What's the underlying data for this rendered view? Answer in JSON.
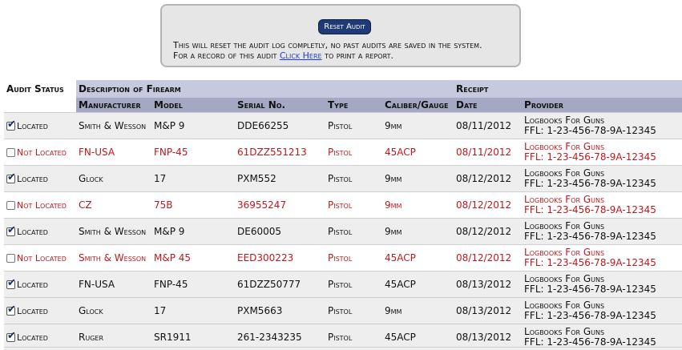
{
  "notice": {
    "reset_label": "Reset Audit",
    "line1": "This will reset the audit log completly, no past audits are saved in the system.",
    "line2_before": "For a record of this audit",
    "link_label": "Click Here",
    "line2_after": "to print a report."
  },
  "table": {
    "headers": {
      "audit_status": "Audit Status",
      "description": "Description of Firearm",
      "receipt": "Receipt",
      "manufacturer": "Manufacturer",
      "model": "Model",
      "serial": "Serial No.",
      "type": "Type",
      "caliber": "Caliber/Gauge",
      "date": "Date",
      "provider": "Provider"
    },
    "rows": [
      {
        "located": true,
        "status": "Located",
        "manufacturer": "Smith & Wesson",
        "model": "M&P 9",
        "serial": "DDE66255",
        "type": "Pistol",
        "caliber": "9mm",
        "date": "08/11/2012",
        "provider_name": "Logbooks For Guns",
        "provider_ffl": "FFL: 1-23-456-78-9A-12345"
      },
      {
        "located": false,
        "status": "Not Located",
        "manufacturer": "FN-USA",
        "model": "FNP-45",
        "serial": "61DZZ551213",
        "type": "Pistol",
        "caliber": "45ACP",
        "date": "08/11/2012",
        "provider_name": "Logbooks For Guns",
        "provider_ffl": "FFL: 1-23-456-78-9A-12345"
      },
      {
        "located": true,
        "status": "Located",
        "manufacturer": "Glock",
        "model": "17",
        "serial": "PXM552",
        "type": "Pistol",
        "caliber": "9mm",
        "date": "08/12/2012",
        "provider_name": "Logbooks For Guns",
        "provider_ffl": "FFL: 1-23-456-78-9A-12345"
      },
      {
        "located": false,
        "status": "Not Located",
        "manufacturer": "CZ",
        "model": "75B",
        "serial": "36955247",
        "type": "Pistol",
        "caliber": "9mm",
        "date": "08/12/2012",
        "provider_name": "Logbooks For Guns",
        "provider_ffl": "FFL: 1-23-456-78-9A-12345"
      },
      {
        "located": true,
        "status": "Located",
        "manufacturer": "Smith & Wesson",
        "model": "M&P 9",
        "serial": "DE60005",
        "type": "Pistol",
        "caliber": "9mm",
        "date": "08/12/2012",
        "provider_name": "Logbooks For Guns",
        "provider_ffl": "FFL: 1-23-456-78-9A-12345"
      },
      {
        "located": false,
        "status": "Not Located",
        "manufacturer": "Smith & Wesson",
        "model": "M&P 45",
        "serial": "EED300223",
        "type": "Pistol",
        "caliber": "45ACP",
        "date": "08/12/2012",
        "provider_name": "Logbooks For Guns",
        "provider_ffl": "FFL: 1-23-456-78-9A-12345"
      },
      {
        "located": true,
        "status": "Located",
        "manufacturer": "FN-USA",
        "model": "FNP-45",
        "serial": "61DZZ50777",
        "type": "Pistol",
        "caliber": "45ACP",
        "date": "08/13/2012",
        "provider_name": "Logbooks For Guns",
        "provider_ffl": "FFL: 1-23-456-78-9A-12345"
      },
      {
        "located": true,
        "status": "Located",
        "manufacturer": "Glock",
        "model": "17",
        "serial": "PXM5663",
        "type": "Pistol",
        "caliber": "9mm",
        "date": "08/13/2012",
        "provider_name": "Logbooks For Guns",
        "provider_ffl": "FFL: 1-23-456-78-9A-12345"
      },
      {
        "located": true,
        "status": "Located",
        "manufacturer": "Ruger",
        "model": "SR1911",
        "serial": "261-2343235",
        "type": "Pistol",
        "caliber": "45ACP",
        "date": "08/13/2012",
        "provider_name": "Logbooks For Guns",
        "provider_ffl": "FFL: 1-23-456-78-9A-12345"
      }
    ]
  },
  "colors": {
    "not_located_text": "#c0181c",
    "button_bg": "#1f3a74",
    "header_top_bg": "#c7c9de",
    "header_sub_bg": "#a5a8c2",
    "located_row_bg": "#eeeeee",
    "link": "#1a3fd0"
  }
}
